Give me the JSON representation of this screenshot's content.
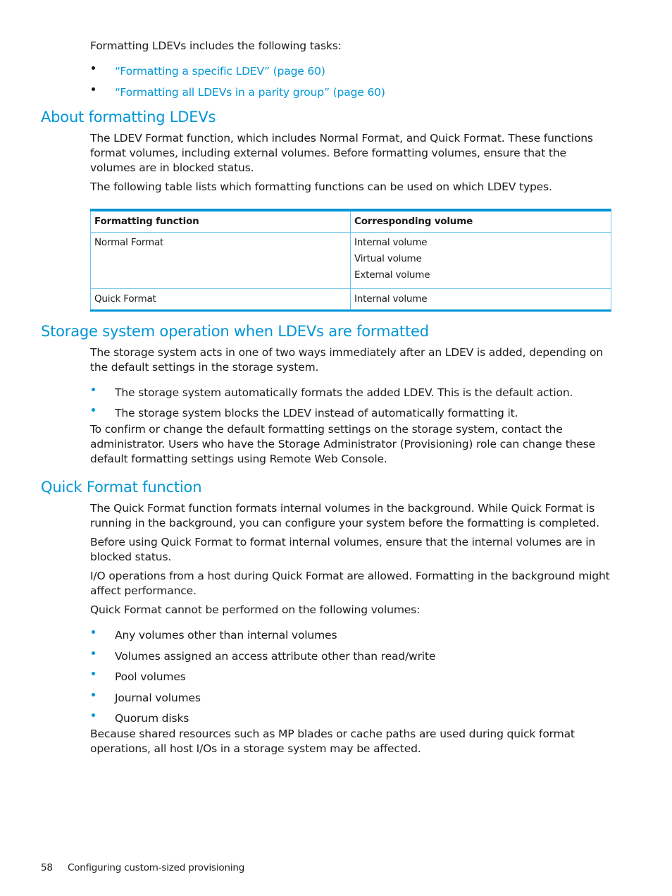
{
  "intro": {
    "text": "Formatting LDEVs includes the following tasks:",
    "links": [
      "“Formatting a specific LDEV” (page 60)",
      "“Formatting all LDEVs in a parity group” (page 60)"
    ]
  },
  "sections": {
    "about": {
      "heading": "About formatting LDEVs",
      "paragraphs": [
        "The LDEV Format function, which includes Normal Format, and Quick Format. These functions format volumes, including external volumes. Before formatting volumes, ensure that the volumes are in blocked status.",
        "The following table lists which formatting functions can be used on which LDEV types."
      ],
      "table": {
        "headers": [
          "Formatting function",
          "Corresponding volume"
        ],
        "rows": [
          {
            "function": "Normal Format",
            "volumes": [
              "Internal volume",
              "Virtual volume",
              "External volume"
            ]
          },
          {
            "function": "Quick Format",
            "volumes": [
              "Internal volume"
            ]
          }
        ]
      }
    },
    "operation": {
      "heading": "Storage system operation when LDEVs are formatted",
      "paragraph": "The storage system acts in one of two ways immediately after an LDEV is added, depending on the default settings in the storage system.",
      "bullets": [
        "The storage system automatically formats the added LDEV. This is the default action.",
        "The storage system blocks the LDEV instead of automatically formatting it."
      ],
      "closing": "To confirm or change the default formatting settings on the storage system, contact the administrator. Users who have the Storage Administrator (Provisioning) role can change these default formatting settings using Remote Web Console."
    },
    "quick": {
      "heading": "Quick Format function",
      "paragraphs": [
        "The Quick Format function formats internal volumes in the background. While Quick Format is running in the background, you can configure your system before the formatting is completed.",
        "Before using Quick Format to format internal volumes, ensure that the internal volumes are in blocked status.",
        "I/O operations from a host during Quick Format are allowed. Formatting in the background might affect performance.",
        "Quick Format cannot be performed on the following volumes:"
      ],
      "bullets": [
        "Any volumes other than internal volumes",
        "Volumes assigned an access attribute other than read/write",
        "Pool volumes",
        "Journal volumes",
        "Quorum disks"
      ],
      "closing": "Because shared resources such as MP blades or cache paths are used during quick format operations, all host I/Os in a storage system may be affected."
    }
  },
  "footer": {
    "page_number": "58",
    "chapter": "Configuring custom-sized provisioning"
  },
  "colors": {
    "accent": "#0096d6",
    "text": "#1a1a1a"
  }
}
